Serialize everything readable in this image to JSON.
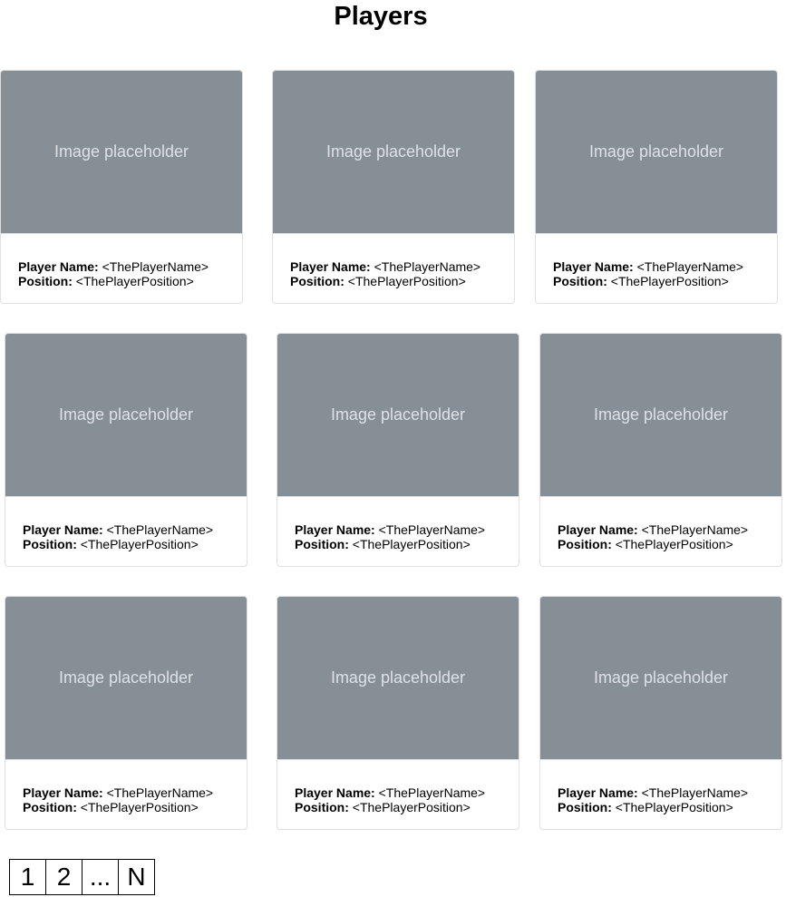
{
  "page": {
    "title": "Players"
  },
  "labels": {
    "name": "Player Name:",
    "position": "Position:"
  },
  "cards": [
    {
      "image_text": "Image placeholder",
      "name": "<ThePlayerName>",
      "position": "<ThePlayerPosition>"
    },
    {
      "image_text": "Image placeholder",
      "name": "<ThePlayerName>",
      "position": "<ThePlayerPosition>"
    },
    {
      "image_text": "Image placeholder",
      "name": "<ThePlayerName>",
      "position": "<ThePlayerPosition>"
    },
    {
      "image_text": "Image placeholder",
      "name": "<ThePlayerName>",
      "position": "<ThePlayerPosition>"
    },
    {
      "image_text": "Image placeholder",
      "name": "<ThePlayerName>",
      "position": "<ThePlayerPosition>"
    },
    {
      "image_text": "Image placeholder",
      "name": "<ThePlayerName>",
      "position": "<ThePlayerPosition>"
    },
    {
      "image_text": "Image placeholder",
      "name": "<ThePlayerName>",
      "position": "<ThePlayerPosition>"
    },
    {
      "image_text": "Image placeholder",
      "name": "<ThePlayerName>",
      "position": "<ThePlayerPosition>"
    },
    {
      "image_text": "Image placeholder",
      "name": "<ThePlayerName>",
      "position": "<ThePlayerPosition>"
    }
  ],
  "pagination": [
    "1",
    "2",
    "...",
    "N"
  ],
  "colors": {
    "image_bg": "#868e96",
    "image_text": "#dee2e6",
    "card_border": "#dfe0e2"
  }
}
